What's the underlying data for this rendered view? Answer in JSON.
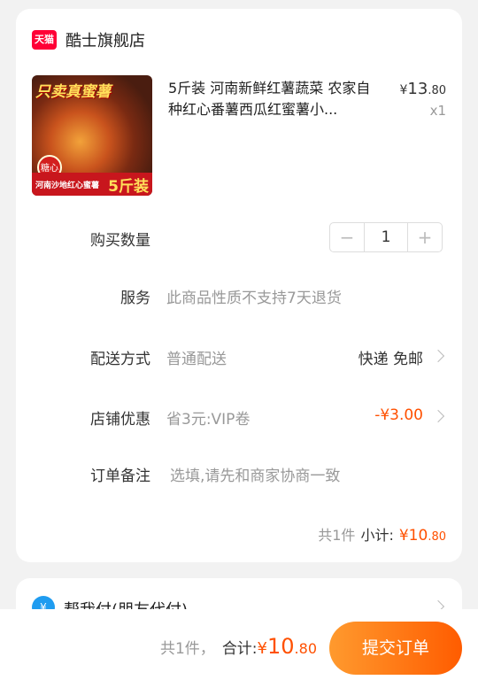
{
  "shop": {
    "badge": "天猫",
    "name": "酷士旗舰店"
  },
  "product": {
    "image": {
      "top_text": "只卖真蜜薯",
      "badge_text": "糖心",
      "band_text": "河南沙地红心蜜薯",
      "band_big": "5斤装"
    },
    "title": "5斤装 河南新鲜红薯蔬菜 农家自种红心番薯西瓜红蜜薯小...",
    "price_symbol": "¥",
    "price_int": "13",
    "price_dec": ".80",
    "quantity_label": "x1"
  },
  "rows": {
    "quantity": {
      "label": "购买数量",
      "minus": "−",
      "value": "1",
      "plus": "+"
    },
    "service": {
      "label": "服务",
      "value": "此商品性质不支持7天退货"
    },
    "shipping": {
      "label": "配送方式",
      "value": "普通配送",
      "right": "快递 免邮"
    },
    "coupon": {
      "label": "店铺优惠",
      "value": "省3元:VIP卷",
      "right": "-¥3.00"
    },
    "note": {
      "label": "订单备注",
      "placeholder": "选填,请先和商家协商一致"
    }
  },
  "subtotal": {
    "count": "共1件",
    "label": "小计:",
    "symbol": "¥",
    "int": "10",
    "dec": ".80"
  },
  "friend_pay": {
    "icon": "¥",
    "label": "帮我付(朋友代付)"
  },
  "bottom": {
    "count": "共1件，",
    "label": "合计:",
    "symbol": "¥",
    "int": "10",
    "dec": ".80",
    "submit": "提交订单"
  },
  "colors": {
    "accent": "#ff5000",
    "tmall": "#ff0036",
    "friend_icon": "#1f9cf0"
  }
}
